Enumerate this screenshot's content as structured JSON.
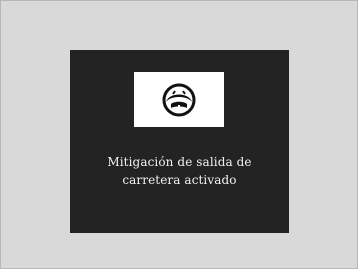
{
  "display": {
    "icon": "road-departure-mitigation-icon",
    "message_line1": "Mitigación de salida de",
    "message_line2": "carretera activado"
  }
}
